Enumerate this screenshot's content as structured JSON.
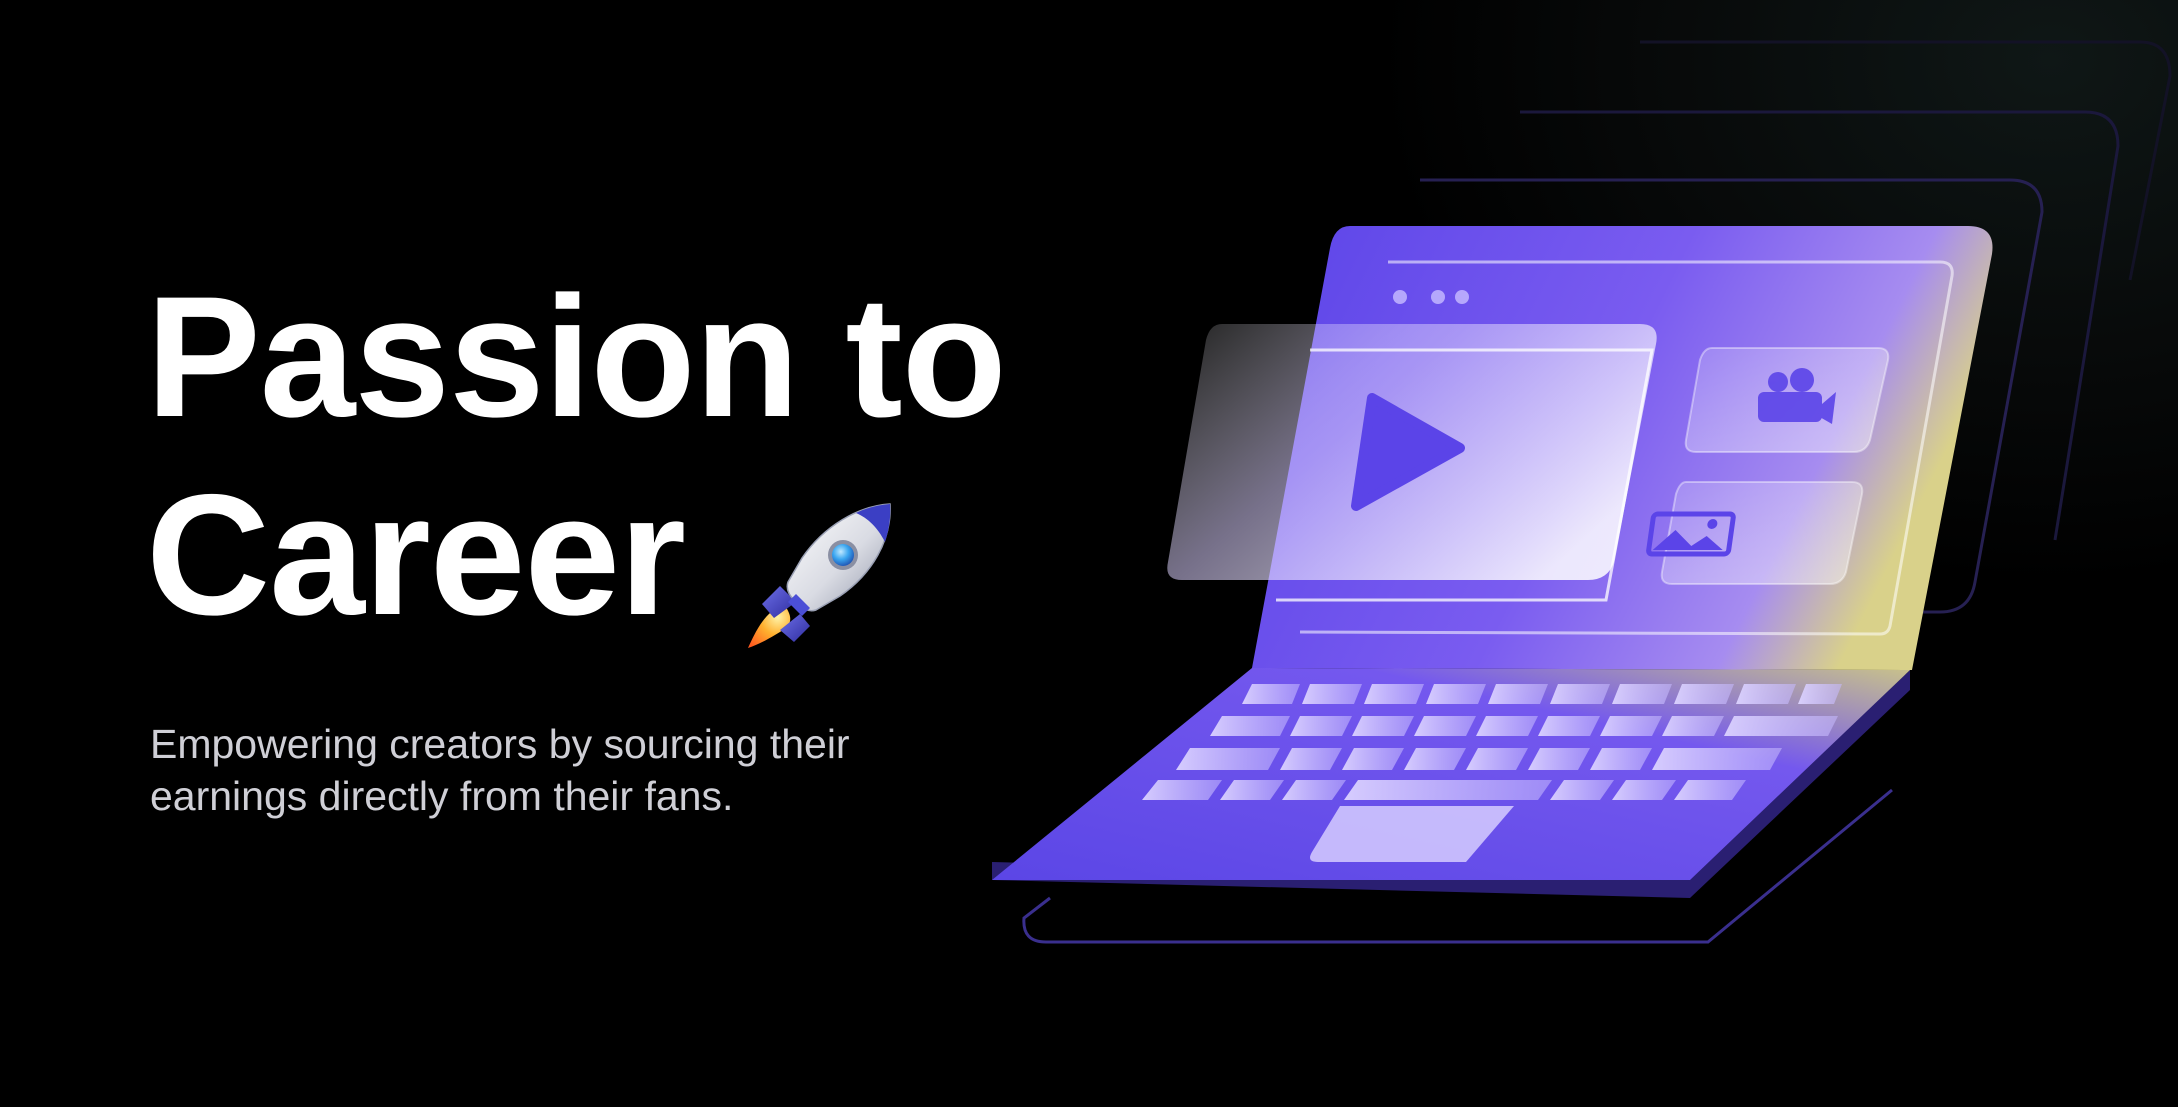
{
  "hero": {
    "title_line1": "Passion to",
    "title_line2": "Career",
    "subtitle_line1": "Empowering creators by sourcing their",
    "subtitle_line2": "earnings directly from their fans."
  },
  "icons": {
    "rocket": "rocket-emoji",
    "laptop": "laptop-illustration",
    "play": "play-icon",
    "video_camera": "video-camera-icon",
    "image": "image-icon"
  },
  "colors": {
    "background": "#000000",
    "title": "#ffffff",
    "subtitle": "#cfcfd6",
    "accent": "#6a4ff0",
    "accent_light": "#b9abff",
    "accent_dark": "#2b1f7a"
  }
}
